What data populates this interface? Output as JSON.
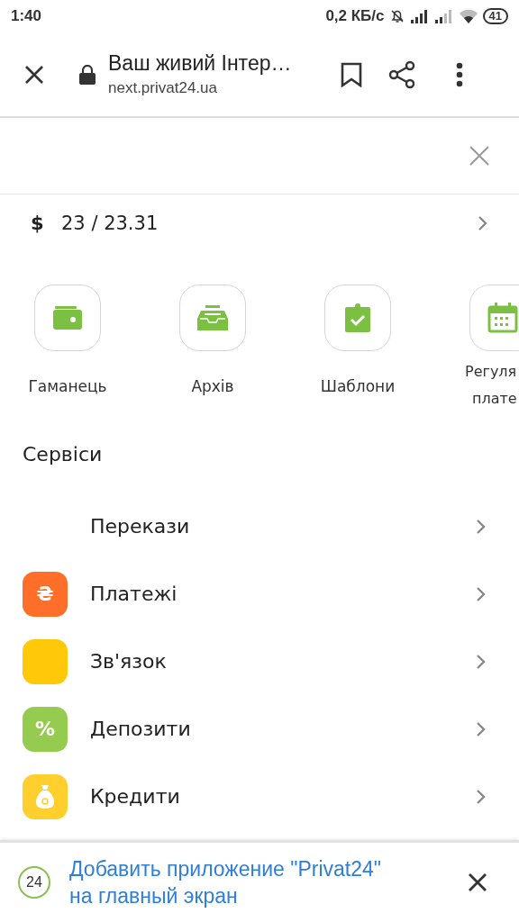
{
  "status_bar": {
    "time": "1:40",
    "speed": "0,2 КБ/с",
    "battery": "41"
  },
  "browser_toolbar": {
    "title": "Ваш живий Інтер…",
    "url": "next.privat24.ua"
  },
  "balance": {
    "currency": "$",
    "value": "23 / 23.31"
  },
  "quick_actions": [
    {
      "kind": "wallet",
      "lines": [
        "Гаманець"
      ]
    },
    {
      "kind": "archive",
      "lines": [
        "Архів"
      ]
    },
    {
      "kind": "templates",
      "lines": [
        "Шаблони"
      ]
    },
    {
      "kind": "calendar",
      "lines": [
        "Регуля",
        "плате"
      ]
    }
  ],
  "services": {
    "title": "Сервіси",
    "items": [
      {
        "label": "Перекази"
      },
      {
        "label": "Платежі",
        "kind": "symbol",
        "symbol": "₴",
        "color": "#ff6f2a"
      },
      {
        "label": "Зв'язок",
        "kind": "blank",
        "color": "#ffc90a"
      },
      {
        "label": "Депозити",
        "kind": "symbol",
        "symbol": "%",
        "color": "#95cc4f"
      },
      {
        "label": "Кредити",
        "kind": "bag",
        "color": "#ffcf2e"
      }
    ]
  },
  "install_banner": {
    "badge": "24",
    "text": "Добавить приложение \"Privat24\" на главный экран"
  }
}
